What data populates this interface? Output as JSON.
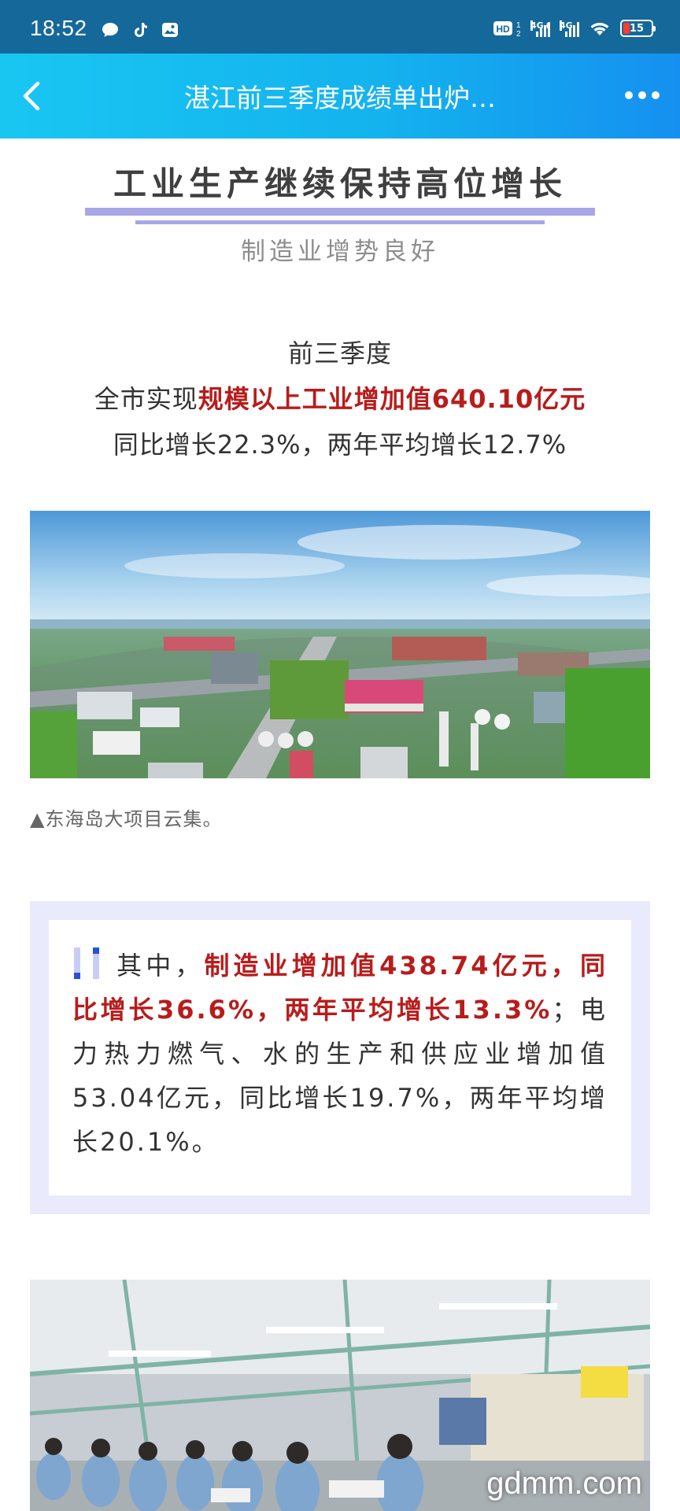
{
  "status_bar": {
    "time": "18:52",
    "hd_label": "HD",
    "sim1_label": "4G+",
    "sim2_label": "4G",
    "battery": "15",
    "icons": [
      "message-icon",
      "tiktok-icon",
      "gallery-icon",
      "wifi-icon"
    ]
  },
  "nav": {
    "title": "湛江前三季度成绩单出炉…",
    "back_icon": "chevron-left-icon",
    "more_icon": "more-dots-icon"
  },
  "article": {
    "heading": "工业生产继续保持高位增长",
    "subheading": "制造业增势良好",
    "stat": {
      "line1": "前三季度",
      "line2_prefix": "全市实现",
      "line2_highlight": "规模以上工业增加值640.10亿元",
      "line3": "同比增长22.3%，两年平均增长12.7%"
    },
    "photo1_alt": "东海岛大项目云集",
    "caption1": "▲东海岛大项目云集。",
    "quote": {
      "prefix": "其中，",
      "highlight": "制造业增加值438.74亿元，同比增长36.6%，两年平均增长13.3%",
      "rest": "；电力热力燃气、水的生产和供应业增加值53.04亿元，同比增长19.7%，两年平均增长20.1%。"
    },
    "watermark": "gdmm.com"
  },
  "colors": {
    "status_bar": "#15689a",
    "nav_gradient_start": "#19c6f2",
    "nav_gradient_end": "#1590f0",
    "highlight_red": "#b81c1c",
    "heading_bar": "#a9a6e8",
    "quote_bg": "#e9ebfc"
  }
}
